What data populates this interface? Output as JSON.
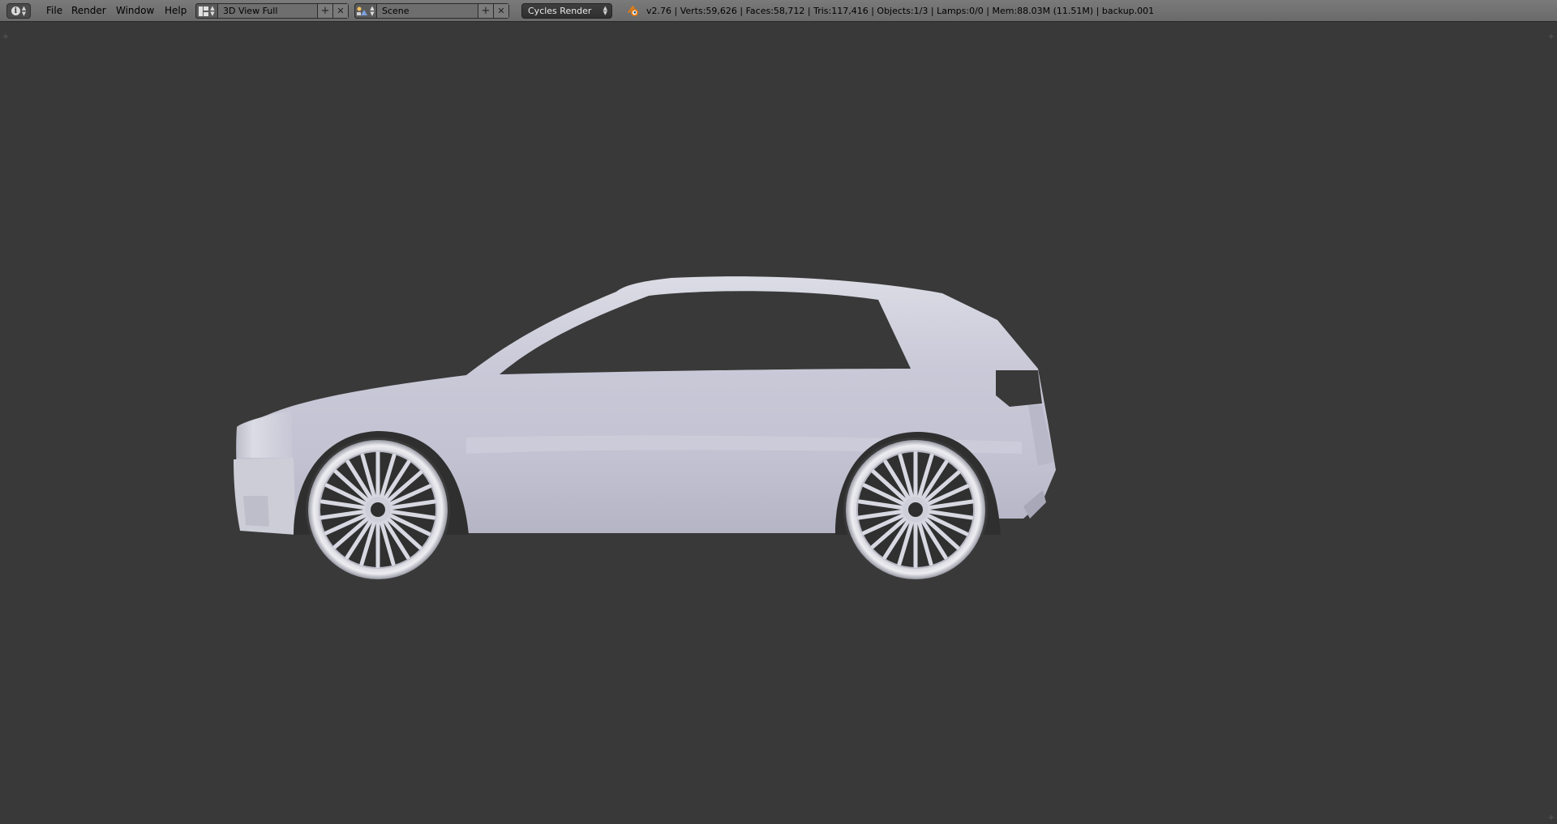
{
  "menu": {
    "items": [
      "File",
      "Render",
      "Window",
      "Help"
    ]
  },
  "screen_layout": {
    "value": "3D View Full"
  },
  "scene": {
    "value": "Scene"
  },
  "render_engine": {
    "value": "Cycles Render"
  },
  "stats": {
    "text": "v2.76 | Verts:59,626 | Faces:58,712 | Tris:117,416 | Objects:1/3 | Lamps:0/0 | Mem:88.03M (11.51M) | backup.001"
  },
  "icons": {
    "editor_type": "info-icon",
    "screen_layout": "layout-icon",
    "scene": "scene-icon",
    "logo": "blender-logo"
  },
  "colors": {
    "viewport_bg": "#393939",
    "header_bg": "#727272",
    "car_body": "#c8c8d6"
  }
}
